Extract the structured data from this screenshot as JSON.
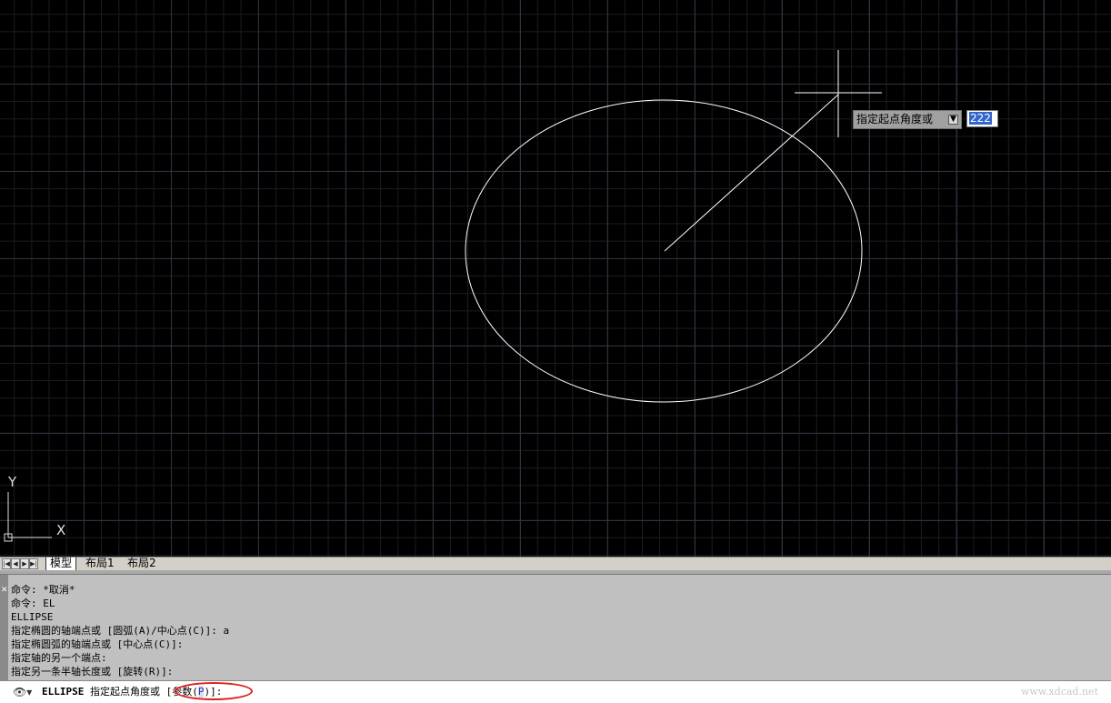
{
  "tooltip": {
    "prompt": "指定起点角度或",
    "expand_icon": "down-arrow-icon",
    "value": "222"
  },
  "ucs": {
    "x_label": "X",
    "y_label": "Y"
  },
  "tabs": [
    {
      "label": "模型",
      "active": true
    },
    {
      "label": "布局1",
      "active": false
    },
    {
      "label": "布局2",
      "active": false
    }
  ],
  "history": [
    "命令: *取消*",
    "命令: EL",
    "ELLIPSE",
    "指定椭圆的轴端点或 [圆弧(A)/中心点(C)]: a",
    "指定椭圆弧的轴端点或 [中心点(C)]:",
    "指定轴的另一个端点:",
    "指定另一条半轴长度或 [旋转(R)]:"
  ],
  "command": {
    "name": "ELLIPSE",
    "prompt": " 指定起点角度或 ",
    "option_open": "[参数(",
    "option_key": "P",
    "option_close": ")]:"
  },
  "watermark": "www.xdcad.net",
  "colors": {
    "canvas": "#000000",
    "grid_major": "#2e3340",
    "ellipse": "#ffffff",
    "highlight": "#e02020"
  }
}
